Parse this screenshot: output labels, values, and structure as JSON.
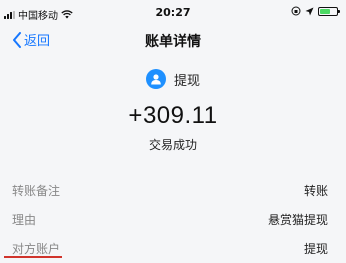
{
  "status_bar": {
    "carrier": "中国移动",
    "time": "20:27"
  },
  "nav": {
    "back_label": "返回",
    "title": "账单详情"
  },
  "transaction": {
    "type_label": "提现",
    "amount": "+309.11",
    "status": "交易成功"
  },
  "details": [
    {
      "label": "转账备注",
      "value": "转账"
    },
    {
      "label": "理由",
      "value": "悬赏猫提现"
    },
    {
      "label": "对方账户",
      "value": "提现"
    }
  ],
  "colors": {
    "accent": "#1677ff",
    "avatar": "#1e90ff",
    "battery": "#4cd964",
    "underline": "#d0342c"
  },
  "icons": {
    "back": "chevron-left-icon",
    "avatar": "user-icon"
  }
}
